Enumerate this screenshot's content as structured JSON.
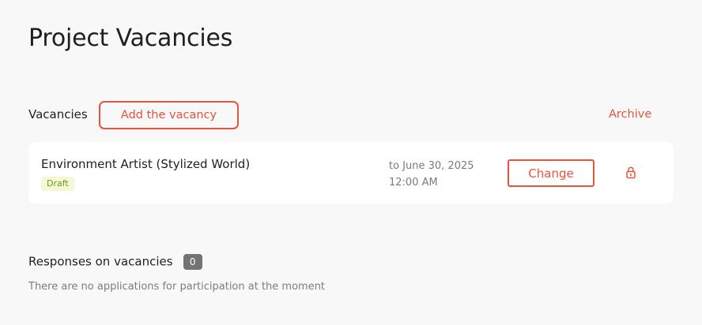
{
  "page": {
    "title": "Project Vacancies"
  },
  "vacancies": {
    "label": "Vacancies",
    "add_button": "Add the vacancy",
    "archive_link": "Archive",
    "items": [
      {
        "title": "Environment Artist (Stylized World)",
        "status": "Draft",
        "date_line": "to June 30, 2025",
        "time_line": "12:00 AM",
        "change_button": "Change",
        "action_icon": "lock-icon"
      }
    ]
  },
  "responses": {
    "label": "Responses on vacancies",
    "count": "0",
    "empty_message": "There are no applications for participation at the moment"
  },
  "colors": {
    "accent": "#e5543f",
    "background": "#f8f8f8",
    "card": "#ffffff",
    "draft_badge_bg": "#f2f9d4",
    "draft_badge_text": "#6f9a22",
    "count_badge_bg": "#737373"
  }
}
